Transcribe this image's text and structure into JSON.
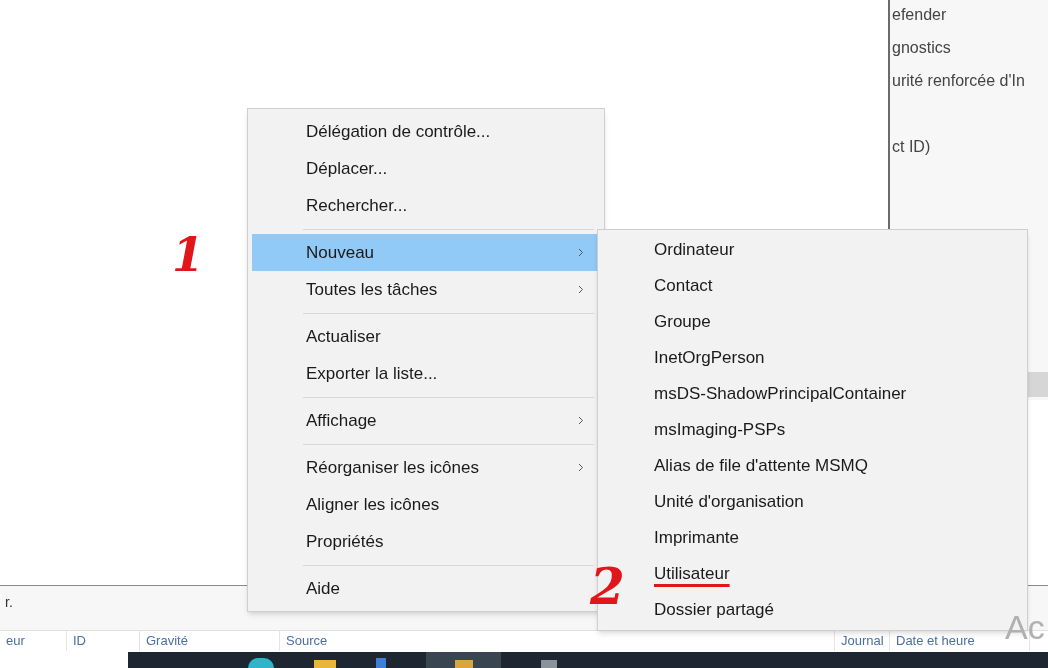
{
  "right_panel": {
    "lines": [
      "efender",
      "gnostics",
      "urité renforcée d'In",
      "ct ID)"
    ]
  },
  "status_text": "r.",
  "table": {
    "columns": [
      "eur",
      "ID",
      "Gravité",
      "Source",
      "Journal",
      "Date et heure"
    ]
  },
  "watermark_text": "Ac",
  "context_menu": {
    "items": [
      {
        "kind": "item",
        "label": "Délégation de contrôle...",
        "submenu": false,
        "selected": false
      },
      {
        "kind": "item",
        "label": "Déplacer...",
        "submenu": false,
        "selected": false
      },
      {
        "kind": "item",
        "label": "Rechercher...",
        "submenu": false,
        "selected": false
      },
      {
        "kind": "separator"
      },
      {
        "kind": "item",
        "label": "Nouveau",
        "submenu": true,
        "selected": true
      },
      {
        "kind": "item",
        "label": "Toutes les tâches",
        "submenu": true,
        "selected": false
      },
      {
        "kind": "separator"
      },
      {
        "kind": "item",
        "label": "Actualiser",
        "submenu": false,
        "selected": false
      },
      {
        "kind": "item",
        "label": "Exporter la liste...",
        "submenu": false,
        "selected": false
      },
      {
        "kind": "separator"
      },
      {
        "kind": "item",
        "label": "Affichage",
        "submenu": true,
        "selected": false
      },
      {
        "kind": "separator"
      },
      {
        "kind": "item",
        "label": "Réorganiser les icônes",
        "submenu": true,
        "selected": false
      },
      {
        "kind": "item",
        "label": "Aligner les icônes",
        "submenu": false,
        "selected": false
      },
      {
        "kind": "item",
        "label": "Propriétés",
        "submenu": false,
        "selected": false
      },
      {
        "kind": "separator"
      },
      {
        "kind": "item",
        "label": "Aide",
        "submenu": false,
        "selected": false
      }
    ]
  },
  "submenu": {
    "items": [
      {
        "label": "Ordinateur",
        "underlined": false
      },
      {
        "label": "Contact",
        "underlined": false
      },
      {
        "label": "Groupe",
        "underlined": false
      },
      {
        "label": "InetOrgPerson",
        "underlined": false
      },
      {
        "label": "msDS-ShadowPrincipalContainer",
        "underlined": false
      },
      {
        "label": "msImaging-PSPs",
        "underlined": false
      },
      {
        "label": "Alias de file d'attente MSMQ",
        "underlined": false
      },
      {
        "label": "Unité d'organisation",
        "underlined": false
      },
      {
        "label": "Imprimante",
        "underlined": false
      },
      {
        "label": "Utilisateur",
        "underlined": true
      },
      {
        "label": "Dossier partagé",
        "underlined": false
      }
    ]
  },
  "annotations": [
    "1",
    "2"
  ]
}
